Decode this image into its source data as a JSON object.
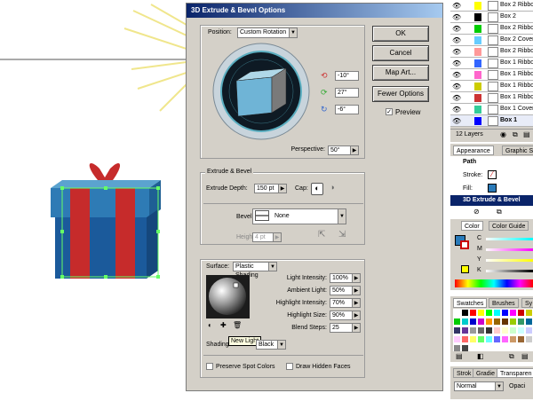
{
  "dialog": {
    "title": "3D Extrude & Bevel Options",
    "position_label": "Position:",
    "position_value": "Custom Rotation",
    "rotation": [
      {
        "value": "-10°",
        "color": "#cc3333"
      },
      {
        "value": "27°",
        "color": "#33aa33"
      },
      {
        "value": "-6°",
        "color": "#3366cc"
      }
    ],
    "perspective_label": "Perspective:",
    "perspective_value": "50°",
    "buttons": {
      "ok": "OK",
      "cancel": "Cancel",
      "map_art": "Map Art...",
      "fewer_options": "Fewer Options"
    },
    "preview_label": "Preview",
    "preview_checked": true,
    "extrude_group": "Extrude & Bevel",
    "extrude_depth_label": "Extrude Depth:",
    "extrude_depth_value": "150 pt",
    "cap_label": "Cap:",
    "bevel_label": "Bevel:",
    "bevel_value": "None",
    "height_label": "Height:",
    "height_value": "4 pt",
    "surface_label": "Surface:",
    "surface_value": "Plastic Shading",
    "light_fields": [
      {
        "label": "Light Intensity:",
        "value": "100%"
      },
      {
        "label": "Ambient Light:",
        "value": "50%"
      },
      {
        "label": "Highlight Intensity:",
        "value": "70%"
      },
      {
        "label": "Highlight Size:",
        "value": "90%"
      },
      {
        "label": "Blend Steps:",
        "value": "25"
      }
    ],
    "tooltip": "New Light",
    "shading_label": "Shading",
    "shading_value": "Black",
    "preserve_spot": "Preserve Spot Colors",
    "draw_hidden": "Draw Hidden Faces"
  },
  "layers": {
    "rows": [
      {
        "name": "Box 2 Ribbo",
        "color": "#ffff00"
      },
      {
        "name": "Box 2",
        "color": "#000000"
      },
      {
        "name": "Box 2 Ribbo",
        "color": "#00cc00"
      },
      {
        "name": "Box 2 Cover",
        "color": "#66ccff"
      },
      {
        "name": "Box 2 Ribbo",
        "color": "#ff9999"
      },
      {
        "name": "Box 1 Ribbo",
        "color": "#3366ff"
      },
      {
        "name": "Box 1 Ribbo",
        "color": "#ff66cc"
      },
      {
        "name": "Box 1 Ribbo",
        "color": "#cccc00"
      },
      {
        "name": "Box 1 Ribbo",
        "color": "#cc3333"
      },
      {
        "name": "Box 1 Cover",
        "color": "#33cc99"
      },
      {
        "name": "Box 1",
        "color": "#0000ff",
        "selected": true
      }
    ],
    "count": "12 Layers"
  },
  "appearance": {
    "tabs": [
      "Appearance",
      "Graphic S"
    ],
    "path_label": "Path",
    "stroke_label": "Stroke:",
    "fill_label": "Fill:",
    "effect_label": "3D Extrude & Bevel"
  },
  "color": {
    "tabs": [
      "Color",
      "Color Guide"
    ],
    "channels": [
      "C",
      "M",
      "Y",
      "K"
    ]
  },
  "swatches": {
    "tabs": [
      "Swatches",
      "Brushes",
      "Sy"
    ]
  },
  "stroke_panel": {
    "tabs": [
      "Strok",
      "Gradie",
      "Transparen"
    ],
    "blend_mode": "Normal",
    "opacity_label": "Opaci"
  }
}
